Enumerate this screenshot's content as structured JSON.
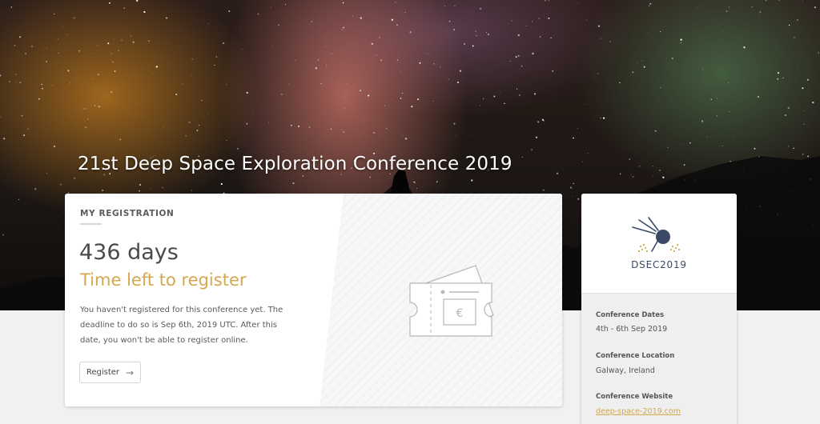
{
  "conference": {
    "title": "21st Deep Space Exploration Conference 2019"
  },
  "registration": {
    "heading": "MY REGISTRATION",
    "days": "436 days",
    "days_subtitle": "Time left to register",
    "description": "You haven't registered for this conference yet. The deadline to do so is Sep 6th, 2019 UTC. After this date, you won't be able to register online.",
    "register_label": "Register",
    "register_arrow": "→",
    "ticket_currency": "€"
  },
  "sidebar": {
    "logo_text": "DSEC2019",
    "dates_label": "Conference Dates",
    "dates_value": "4th - 6th Sep 2019",
    "location_label": "Conference Location",
    "location_value": "Galway, Ireland",
    "website_label": "Conference Website",
    "website_value": "deep-space-2019.com"
  },
  "colors": {
    "accent": "#d4a84e",
    "logo": "#3a4a66"
  }
}
